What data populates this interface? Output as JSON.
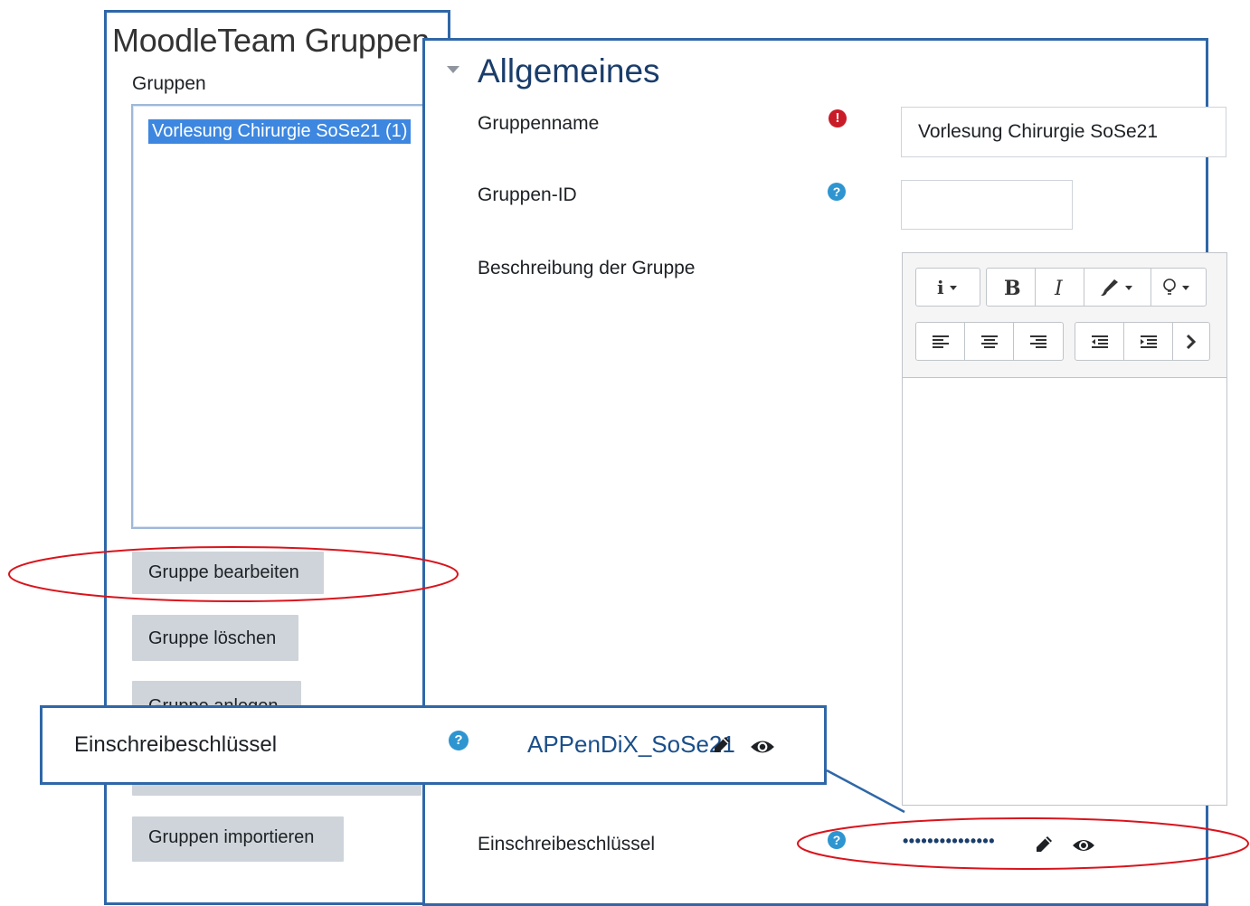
{
  "left_panel": {
    "title": "MoodleTeam Gruppen",
    "groups_label": "Gruppen",
    "selected_group": "Vorlesung Chirurgie SoSe21 (1)",
    "buttons": {
      "edit": "Gruppe bearbeiten",
      "delete": "Gruppe löschen",
      "create": "Gruppe anlegen",
      "import": "Gruppen importieren"
    }
  },
  "form": {
    "section_heading": "Allgemeines",
    "group_name_label": "Gruppenname",
    "group_name_value": "Vorlesung Chirurgie SoSe21",
    "group_id_label": "Gruppen-ID",
    "group_id_value": "",
    "description_label": "Beschreibung der Gruppe",
    "enrolment_key_label": "Einschreibeschlüssel",
    "enrolment_key_masked": "•••••••••••••••"
  },
  "editor_toolbar": {
    "row1": [
      {
        "name": "info-icon",
        "glyph": "i ▾"
      },
      {
        "name": "bold-icon",
        "glyph": "B"
      },
      {
        "name": "italic-icon",
        "glyph": "I"
      },
      {
        "name": "brush-icon",
        "glyph": "🖌▾"
      },
      {
        "name": "lightbulb-icon",
        "glyph": "♀▾"
      }
    ],
    "row2": [
      {
        "name": "align-left-icon",
        "glyph": "≡"
      },
      {
        "name": "align-center-icon",
        "glyph": "≡"
      },
      {
        "name": "align-right-icon",
        "glyph": "≡"
      },
      {
        "name": "outdent-icon",
        "glyph": "⇤"
      },
      {
        "name": "indent-icon",
        "glyph": "⇥"
      },
      {
        "name": "more-icon",
        "glyph": "›"
      }
    ]
  },
  "callout": {
    "label": "Einschreibeschlüssel",
    "value": "APPenDiX_SoSe21"
  },
  "icons": {
    "required": "!",
    "help": "?"
  },
  "colors": {
    "frame_blue": "#2f67a8",
    "highlight_red": "#d9141c",
    "selection_blue": "#3d87e0",
    "heading_navy": "#1a3d6b",
    "button_gray": "#ced4da"
  }
}
